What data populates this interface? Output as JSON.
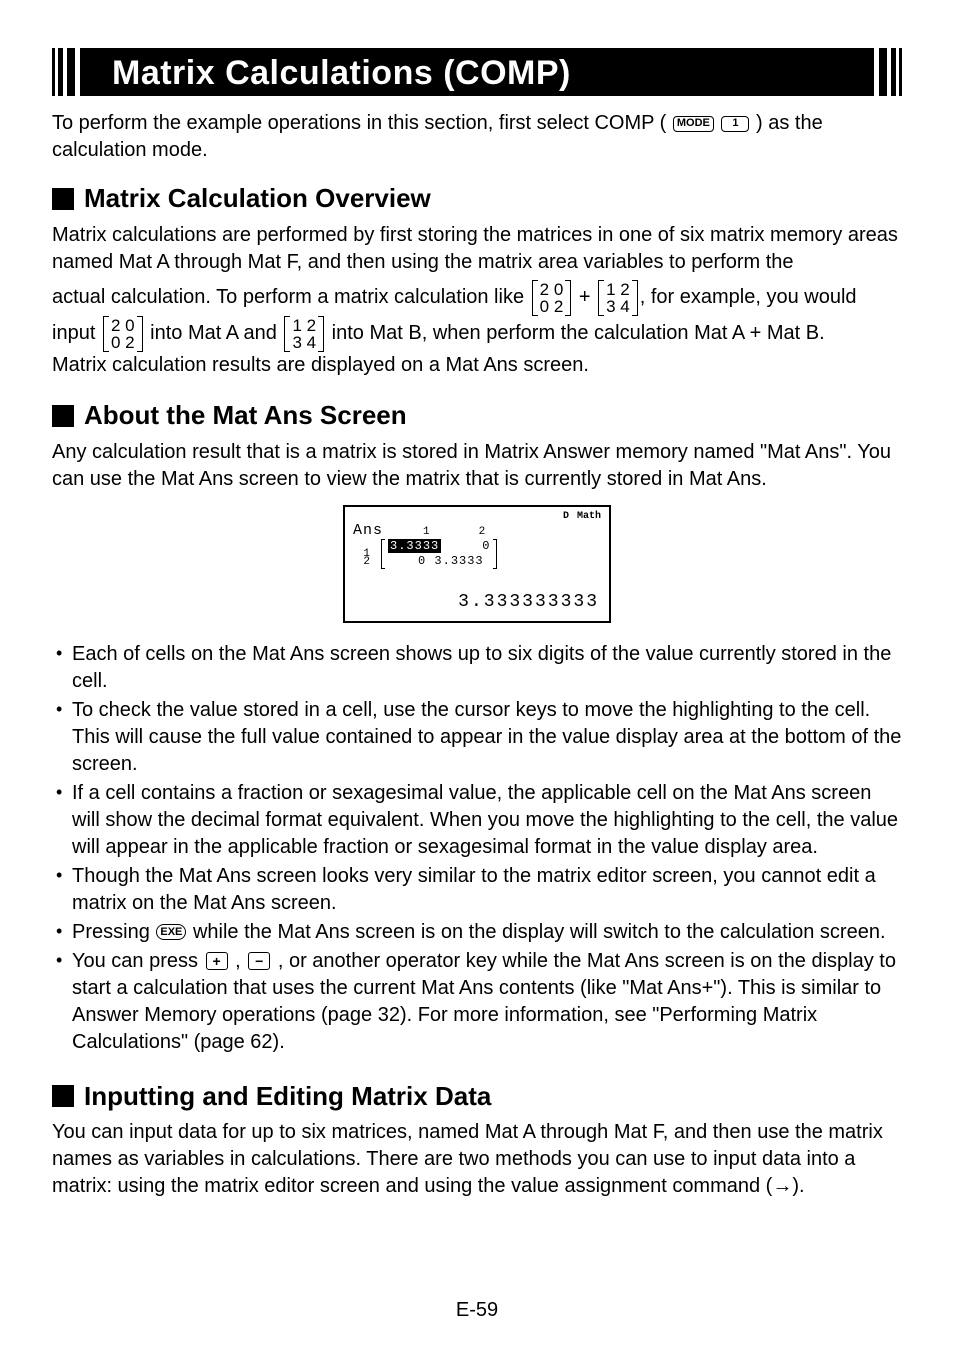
{
  "title": "Matrix Calculations (COMP)",
  "intro": {
    "text1": "To perform the example operations in this section, first select COMP (",
    "key_mode": "MODE",
    "key_one": "1",
    "text2": ") as the calculation mode."
  },
  "overview": {
    "heading": "Matrix Calculation Overview",
    "para1": "Matrix calculations are performed by first storing the matrices in one of six matrix memory areas named Mat A through Mat F, and then using the matrix area variables to perform the",
    "para2a": "actual calculation. To perform a matrix calculation like",
    "m1r1": "2 0",
    "m1r2": "0 2",
    "plus": "+",
    "m2r1": "1 2",
    "m2r2": "3 4",
    "para2b": ", for example, you would",
    "para3a": "input",
    "para3b": "into Mat A and",
    "para3c": "into Mat B, when perform the calculation Mat A + Mat B.",
    "para4": "Matrix calculation results are displayed on a Mat Ans screen."
  },
  "matans": {
    "heading": "About the Mat Ans Screen",
    "para": "Any calculation result that is a matrix is stored in Matrix Answer memory named \"Mat Ans\". You can use the Mat Ans screen to view the matrix that is currently stored in Mat Ans.",
    "screen": {
      "ind1": "D",
      "ind2": "Math",
      "label": "Ans",
      "col1": "1",
      "col2": "2",
      "row1": "1",
      "row2": "2",
      "cell11": "3.3333",
      "cell12": "0",
      "cell21": "0",
      "cell22": "3.3333",
      "result": "3.333333333"
    },
    "bullets": [
      "Each of cells on the Mat Ans screen shows up to six digits of the value currently stored in the cell.",
      "To check the value stored in a cell, use the cursor keys to move the highlighting to the cell. This will cause the full value contained to appear in the value display area at the bottom of the screen.",
      "If a cell contains a fraction or sexagesimal value, the applicable cell on the Mat Ans screen will show the decimal format equivalent. When you move the highlighting to the cell, the value will appear in the applicable fraction or sexagesimal format in the value display area.",
      "Though the Mat Ans screen looks very similar to the matrix editor screen, you cannot edit a matrix on the Mat Ans screen."
    ],
    "bullet5a": "Pressing ",
    "key_exe": "EXE",
    "bullet5b": " while the Mat Ans screen is on the display will switch to the calculation screen.",
    "bullet6a": "You can press ",
    "key_plus": "+",
    "comma": ", ",
    "key_minus": "−",
    "bullet6b": ", or another operator key while the Mat Ans screen is on the display to start a calculation that uses the current Mat Ans contents (like \"Mat Ans+\"). This is similar to Answer Memory operations (page 32). For more information, see \"Performing Matrix Calculations\" (page 62)."
  },
  "inputting": {
    "heading": "Inputting and Editing Matrix Data",
    "para": "You can input data for up to six matrices, named Mat A through Mat F, and then use the matrix names as variables in calculations. There are two methods you can use to input data into a matrix: using the matrix editor screen and using the value assignment command (→)."
  },
  "page_number": "E-59"
}
